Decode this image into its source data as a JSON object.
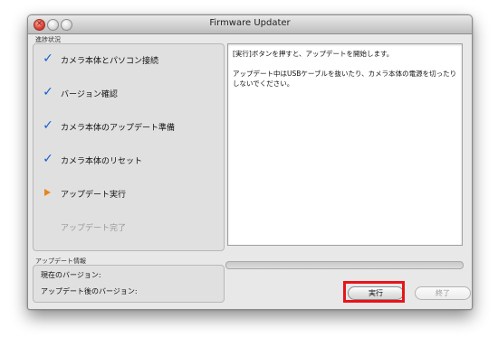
{
  "window": {
    "title": "Firmware Updater"
  },
  "progress_section": {
    "label": "進捗状況",
    "steps": [
      {
        "label": "カメラ本体とパソコン接続",
        "status": "done",
        "mark": "✓"
      },
      {
        "label": "バージョン確認",
        "status": "done",
        "mark": "✓"
      },
      {
        "label": "カメラ本体のアップデート準備",
        "status": "done",
        "mark": "✓"
      },
      {
        "label": "カメラ本体のリセット",
        "status": "done",
        "mark": "✓"
      },
      {
        "label": "アップデート実行",
        "status": "current"
      },
      {
        "label": "アップデート完了",
        "status": "pending"
      }
    ]
  },
  "message_area": {
    "line1": "[実行]ボタンを押すと、アップデートを開始します。",
    "line2": "アップデート中はUSBケーブルを抜いたり、カメラ本体の電源を切ったりしないでください。"
  },
  "progress_bar": {
    "value": 0
  },
  "update_info": {
    "label": "アップデート情報",
    "current_version_label": "現在のバージョン:",
    "updated_version_label": "アップデート後のバージョン:"
  },
  "buttons": {
    "execute_label": "実行",
    "quit_label": "終了"
  },
  "colors": {
    "checkmark": "#1a5fd0",
    "current_arrow": "#e8861c",
    "highlight": "#e8141b"
  }
}
